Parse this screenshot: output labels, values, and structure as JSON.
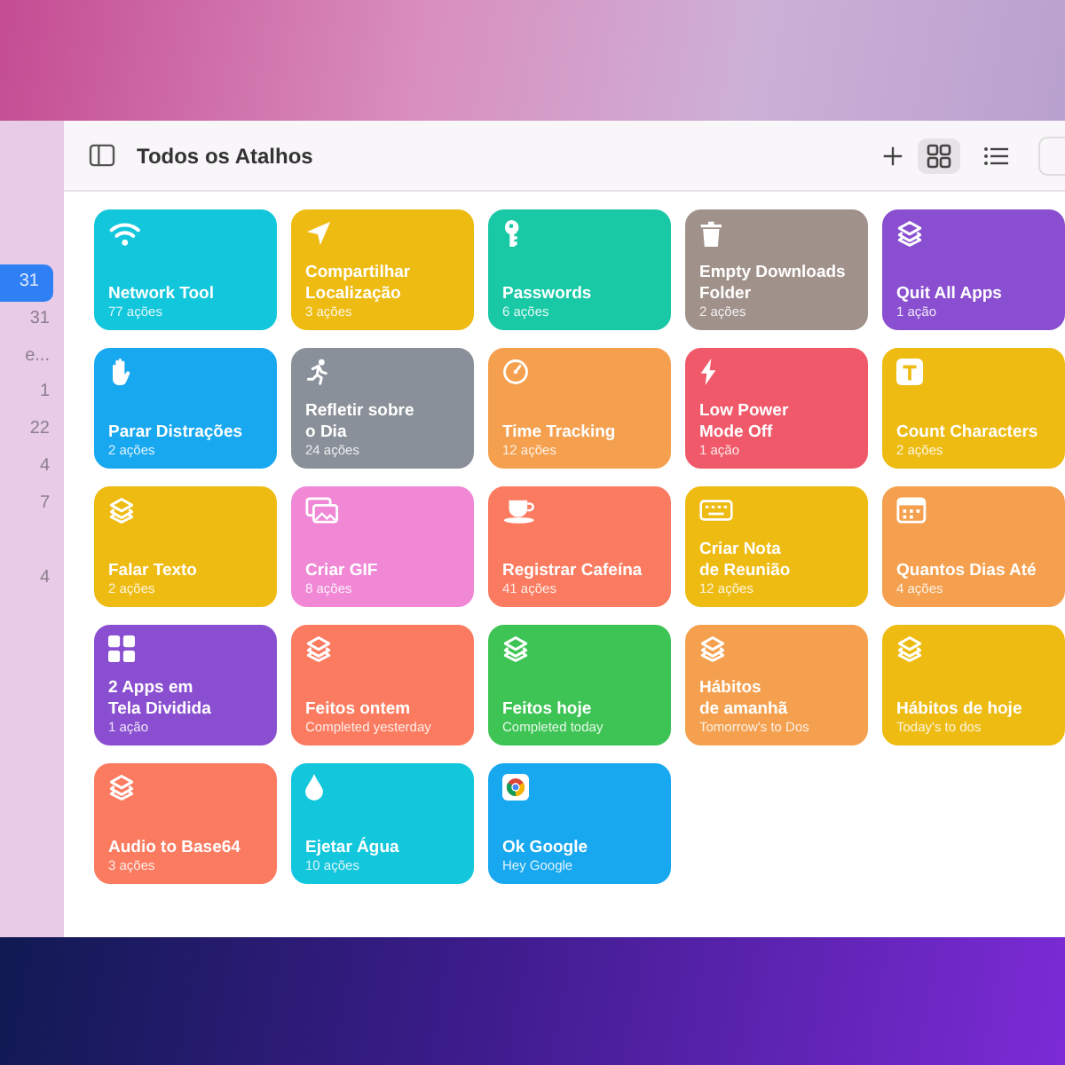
{
  "sidebar": {
    "groups": [
      [
        {
          "label": "31",
          "selected": true
        },
        {
          "label": "31",
          "selected": false
        },
        {
          "label": "e...",
          "selected": false
        },
        {
          "label": "1",
          "selected": false
        },
        {
          "label": "22",
          "selected": false
        },
        {
          "label": "4",
          "selected": false
        },
        {
          "label": "7",
          "selected": false
        }
      ],
      [
        {
          "label": "4",
          "selected": false
        }
      ]
    ]
  },
  "toolbar": {
    "title": "Todos os Atalhos",
    "view_buttons": [
      {
        "kind": "grid",
        "selected": true
      },
      {
        "kind": "list",
        "selected": false
      }
    ]
  },
  "shortcuts": [
    {
      "title_lines": [
        "Network Tool"
      ],
      "subtitle": "77 ações",
      "color": "#12c6dc",
      "kind": "wifi"
    },
    {
      "title_lines": [
        "Compartilhar",
        "Localização"
      ],
      "subtitle": "3 ações",
      "color": "#eebb12",
      "kind": "location"
    },
    {
      "title_lines": [
        "Passwords"
      ],
      "subtitle": "6 ações",
      "color": "#19c9a6",
      "kind": "key"
    },
    {
      "title_lines": [
        "Empty Downloads",
        "Folder"
      ],
      "subtitle": "2 ações",
      "color": "#a0918a",
      "kind": "trash"
    },
    {
      "title_lines": [
        "Quit All Apps"
      ],
      "subtitle": "1 ação",
      "color": "#8a4fd0",
      "kind": "layers"
    },
    {
      "title_lines": [
        "Parar Distrações"
      ],
      "subtitle": "2 ações",
      "color": "#18a8f0",
      "kind": "hand"
    },
    {
      "title_lines": [
        "Refletir sobre",
        "o Dia"
      ],
      "subtitle": "24 ações",
      "color": "#8a9099",
      "kind": "runner"
    },
    {
      "title_lines": [
        "Time Tracking"
      ],
      "subtitle": "12 ações",
      "color": "#f4a04e",
      "kind": "gauge"
    },
    {
      "title_lines": [
        "Low Power",
        "Mode Off"
      ],
      "subtitle": "1 ação",
      "color": "#f0596a",
      "kind": "bolt"
    },
    {
      "title_lines": [
        "Count Characters"
      ],
      "subtitle": "2 ações",
      "color": "#eebb12",
      "kind": "text"
    },
    {
      "title_lines": [
        "Falar Texto"
      ],
      "subtitle": "2 ações",
      "color": "#eebb12",
      "kind": "layers"
    },
    {
      "title_lines": [
        "Criar GIF"
      ],
      "subtitle": "8 ações",
      "color": "#f088d6",
      "kind": "photos"
    },
    {
      "title_lines": [
        "Registrar Cafeína"
      ],
      "subtitle": "41 ações",
      "color": "#fb7b60",
      "kind": "cup"
    },
    {
      "title_lines": [
        "Criar Nota",
        "de Reunião"
      ],
      "subtitle": "12 ações",
      "color": "#eebb12",
      "kind": "keyboard"
    },
    {
      "title_lines": [
        "Quantos Dias Até"
      ],
      "subtitle": "4 ações",
      "color": "#f4a04e",
      "kind": "calendar"
    },
    {
      "title_lines": [
        "2 Apps em",
        "Tela Dividida"
      ],
      "subtitle": "1 ação",
      "color": "#8a4fd0",
      "kind": "grid"
    },
    {
      "title_lines": [
        "Feitos ontem"
      ],
      "subtitle": "Completed yesterday",
      "color": "#fb7b60",
      "kind": "layers"
    },
    {
      "title_lines": [
        "Feitos hoje"
      ],
      "subtitle": "Completed today",
      "color": "#3ec455",
      "kind": "layers"
    },
    {
      "title_lines": [
        "Hábitos",
        "de amanhã"
      ],
      "subtitle": "Tomorrow's to Dos",
      "color": "#f4a04e",
      "kind": "layers"
    },
    {
      "title_lines": [
        "Hábitos de hoje"
      ],
      "subtitle": "Today's to dos",
      "color": "#eebb12",
      "kind": "layers"
    },
    {
      "title_lines": [
        "Audio to Base64"
      ],
      "subtitle": "3 ações",
      "color": "#fb7b60",
      "kind": "layers"
    },
    {
      "title_lines": [
        "Ejetar Água"
      ],
      "subtitle": "10 ações",
      "color": "#12c6dc",
      "kind": "drop"
    },
    {
      "title_lines": [
        "Ok Google"
      ],
      "subtitle": "Hey Google",
      "color": "#18a8f0",
      "kind": "chrome"
    }
  ]
}
